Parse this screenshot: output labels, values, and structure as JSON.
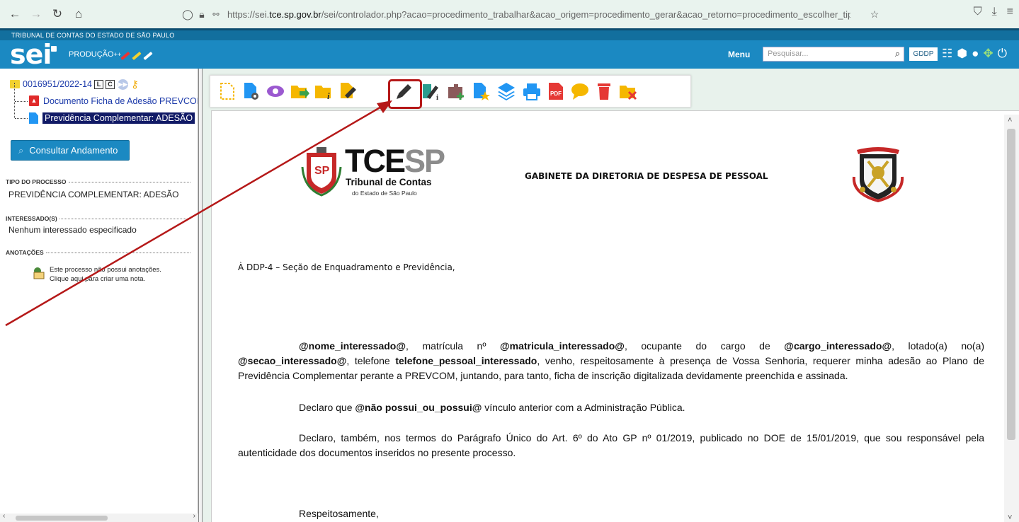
{
  "browser": {
    "url_prefix": "https://sei.",
    "url_domain": "tce.sp.gov.br",
    "url_rest": "/sei/controlador.php?acao=procedimento_trabalhar&acao_origem=procedimento_gerar&acao_retorno=procedimento_escolher_tipo&id_"
  },
  "header": {
    "org_name": "TRIBUNAL DE CONTAS DO ESTADO DE SÃO PAULO",
    "logo_text": "sei",
    "environment": "PRODUÇÃO",
    "env_suffix": "++",
    "menu_label": "Menu",
    "search_placeholder": "Pesquisar...",
    "unit": "GDDP"
  },
  "tree": {
    "process_number": "0016951/2022-14",
    "badge_l": "L",
    "badge_c": "C",
    "doc1_label": "Documento Ficha de Adesão PREVCOM",
    "doc2_label": "Previdência Complementar: ADESÃO"
  },
  "sidebar": {
    "consult_button": "Consultar Andamento",
    "process_type_title": "TIPO DO PROCESSO",
    "process_type_value": "PREVIDÊNCIA COMPLEMENTAR: ADESÃO",
    "interested_title": "INTERESSADO(S)",
    "interested_value": "Nenhum interessado especificado",
    "notes_title": "ANOTAÇÕES",
    "notes_text": "Este processo não possui anotações. Clique aqui para criar uma nota."
  },
  "toolbar": {
    "icons": [
      "new-document-icon",
      "process-settings-icon",
      "view-icon",
      "send-process-icon",
      "process-info-icon",
      "document-edit-icon",
      "edit-content-icon",
      "sign-document-icon",
      "add-block-icon",
      "favorite-document-icon",
      "layers-icon",
      "print-icon",
      "pdf-icon",
      "comment-icon",
      "delete-icon",
      "close-process-icon"
    ],
    "highlighted_icon": "edit-content-icon"
  },
  "document": {
    "logo_title_main": "TCE",
    "logo_title_accent": "SP",
    "logo_sub1": "Tribunal de Contas",
    "logo_sub2": "do Estado de São Paulo",
    "heading": "GABINETE DA DIRETORIA DE DESPESA DE PESSOAL",
    "addressee": "À DDP-4 – Seção de Enquadramento e Previdência,",
    "p1_l1_parts": [
      "@nome_interessado@",
      ", matrícula nº ",
      "@matricula_interessado@",
      ", ocupante do cargo de ",
      "@cargo_interessado@",
      ", lotado(a) no(a)"
    ],
    "p1_l2_parts": [
      "@secao_interessado@",
      ", telefone ",
      "telefone_pessoal_interessado",
      ", venho, respeitosamente à presença de Vossa Senhoria, requerer minha adesão ao Plano de"
    ],
    "p1_l3": "Previdência Complementar perante a PREVCOM, juntando, para tanto,  ficha de inscrição digitalizada devidamente preenchida e assinada.",
    "p2_parts": [
      "Declaro que ",
      "@não possui_ou_possui@",
      " vínculo anterior com a Administração Pública."
    ],
    "p3_l1": "Declaro, também, nos termos do Parágrafo Único do Art. 6º do Ato GP nº 01/2019, publicado no DOE de 15/01/2019, que sou responsável pela",
    "p3_l2": "autenticidade dos documentos inseridos no presente processo.",
    "closing": "Respeitosamente,"
  },
  "colors": {
    "header_blue": "#1b89c2",
    "header_dark": "#126f9e",
    "highlight_red": "#b51818",
    "link_blue": "#1c3aaa",
    "selected_bg": "#111a66"
  }
}
